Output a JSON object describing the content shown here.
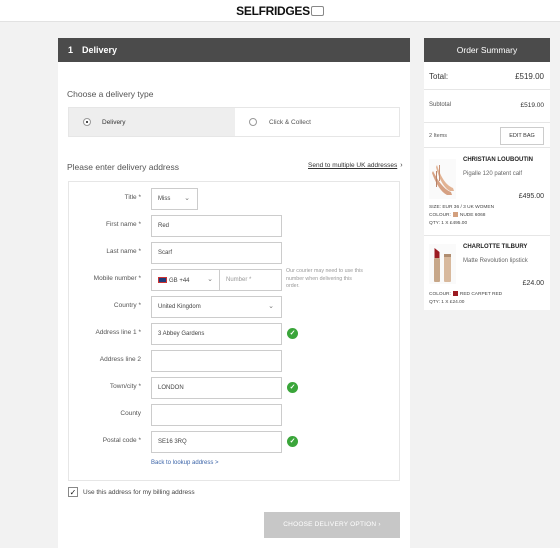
{
  "header": {
    "logo": "SELFRIDGES"
  },
  "checkout": {
    "step_number": "1",
    "step_title": "Delivery",
    "delivery_type_label": "Choose a delivery type",
    "delivery_options": [
      {
        "label": "Delivery",
        "selected": true
      },
      {
        "label": "Click & Collect",
        "selected": false
      }
    ],
    "address_label": "Please enter delivery address",
    "multi_address_link": "Send to multiple UK addresses",
    "multi_address_chevron": "›",
    "fields": {
      "title": {
        "label": "Title *",
        "value": "Miss"
      },
      "first_name": {
        "label": "First name *",
        "value": "Red"
      },
      "last_name": {
        "label": "Last name *",
        "value": "Scarf"
      },
      "mobile": {
        "label": "Mobile number *",
        "code": "GB +44",
        "placeholder": "Number *",
        "hint": "Our courier may need to use this number when delivering this order."
      },
      "country": {
        "label": "Country *",
        "value": "United Kingdom"
      },
      "address1": {
        "label": "Address line 1 *",
        "value": "3 Abbey Gardens"
      },
      "address2": {
        "label": "Address line 2",
        "value": ""
      },
      "town": {
        "label": "Town/city *",
        "value": "LONDON"
      },
      "county": {
        "label": "County",
        "value": ""
      },
      "postcode": {
        "label": "Postal code *",
        "value": "SE16 3RQ"
      }
    },
    "lookup_link": "Back to lookup address >",
    "billing_checkbox": {
      "label": "Use this address for my billing address",
      "checked": true
    },
    "cta_label": "CHOOSE DELIVERY OPTION",
    "cta_chevron": "›"
  },
  "summary": {
    "title": "Order Summary",
    "total_label": "Total:",
    "total_value": "£519.00",
    "subtotal_label": "Subtotal",
    "subtotal_value": "£519.00",
    "items_count": "2 Items",
    "edit_bag": "EDIT BAG",
    "products": [
      {
        "brand": "CHRISTIAN LOUBOUTIN",
        "desc": "Pigalle 120 patent calf",
        "price": "£495.00",
        "size": "SIZE: EUR 36 / 3 UK WOMEN",
        "colour": "COLOUR:",
        "colour_name": "NUDE 6068",
        "colour_hex": "#d3a07e",
        "qty": "QTY: 1 X £495.00"
      },
      {
        "brand": "CHARLOTTE TILBURY",
        "desc": "Matte Revolution lipstick",
        "price": "£24.00",
        "colour": "COLOUR:",
        "colour_name": "RED CARPET RED",
        "colour_hex": "#9b1b22",
        "qty": "QTY: 1 X £24.00"
      }
    ]
  }
}
